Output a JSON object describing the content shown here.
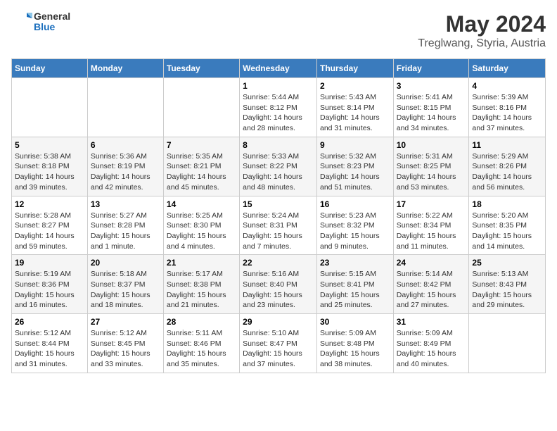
{
  "logo": {
    "general": "General",
    "blue": "Blue"
  },
  "header": {
    "month_year": "May 2024",
    "location": "Treglwang, Styria, Austria"
  },
  "weekdays": [
    "Sunday",
    "Monday",
    "Tuesday",
    "Wednesday",
    "Thursday",
    "Friday",
    "Saturday"
  ],
  "weeks": [
    [
      {
        "day": "",
        "info": ""
      },
      {
        "day": "",
        "info": ""
      },
      {
        "day": "",
        "info": ""
      },
      {
        "day": "1",
        "info": "Sunrise: 5:44 AM\nSunset: 8:12 PM\nDaylight: 14 hours and 28 minutes."
      },
      {
        "day": "2",
        "info": "Sunrise: 5:43 AM\nSunset: 8:14 PM\nDaylight: 14 hours and 31 minutes."
      },
      {
        "day": "3",
        "info": "Sunrise: 5:41 AM\nSunset: 8:15 PM\nDaylight: 14 hours and 34 minutes."
      },
      {
        "day": "4",
        "info": "Sunrise: 5:39 AM\nSunset: 8:16 PM\nDaylight: 14 hours and 37 minutes."
      }
    ],
    [
      {
        "day": "5",
        "info": "Sunrise: 5:38 AM\nSunset: 8:18 PM\nDaylight: 14 hours and 39 minutes."
      },
      {
        "day": "6",
        "info": "Sunrise: 5:36 AM\nSunset: 8:19 PM\nDaylight: 14 hours and 42 minutes."
      },
      {
        "day": "7",
        "info": "Sunrise: 5:35 AM\nSunset: 8:21 PM\nDaylight: 14 hours and 45 minutes."
      },
      {
        "day": "8",
        "info": "Sunrise: 5:33 AM\nSunset: 8:22 PM\nDaylight: 14 hours and 48 minutes."
      },
      {
        "day": "9",
        "info": "Sunrise: 5:32 AM\nSunset: 8:23 PM\nDaylight: 14 hours and 51 minutes."
      },
      {
        "day": "10",
        "info": "Sunrise: 5:31 AM\nSunset: 8:25 PM\nDaylight: 14 hours and 53 minutes."
      },
      {
        "day": "11",
        "info": "Sunrise: 5:29 AM\nSunset: 8:26 PM\nDaylight: 14 hours and 56 minutes."
      }
    ],
    [
      {
        "day": "12",
        "info": "Sunrise: 5:28 AM\nSunset: 8:27 PM\nDaylight: 14 hours and 59 minutes."
      },
      {
        "day": "13",
        "info": "Sunrise: 5:27 AM\nSunset: 8:28 PM\nDaylight: 15 hours and 1 minute."
      },
      {
        "day": "14",
        "info": "Sunrise: 5:25 AM\nSunset: 8:30 PM\nDaylight: 15 hours and 4 minutes."
      },
      {
        "day": "15",
        "info": "Sunrise: 5:24 AM\nSunset: 8:31 PM\nDaylight: 15 hours and 7 minutes."
      },
      {
        "day": "16",
        "info": "Sunrise: 5:23 AM\nSunset: 8:32 PM\nDaylight: 15 hours and 9 minutes."
      },
      {
        "day": "17",
        "info": "Sunrise: 5:22 AM\nSunset: 8:34 PM\nDaylight: 15 hours and 11 minutes."
      },
      {
        "day": "18",
        "info": "Sunrise: 5:20 AM\nSunset: 8:35 PM\nDaylight: 15 hours and 14 minutes."
      }
    ],
    [
      {
        "day": "19",
        "info": "Sunrise: 5:19 AM\nSunset: 8:36 PM\nDaylight: 15 hours and 16 minutes."
      },
      {
        "day": "20",
        "info": "Sunrise: 5:18 AM\nSunset: 8:37 PM\nDaylight: 15 hours and 18 minutes."
      },
      {
        "day": "21",
        "info": "Sunrise: 5:17 AM\nSunset: 8:38 PM\nDaylight: 15 hours and 21 minutes."
      },
      {
        "day": "22",
        "info": "Sunrise: 5:16 AM\nSunset: 8:40 PM\nDaylight: 15 hours and 23 minutes."
      },
      {
        "day": "23",
        "info": "Sunrise: 5:15 AM\nSunset: 8:41 PM\nDaylight: 15 hours and 25 minutes."
      },
      {
        "day": "24",
        "info": "Sunrise: 5:14 AM\nSunset: 8:42 PM\nDaylight: 15 hours and 27 minutes."
      },
      {
        "day": "25",
        "info": "Sunrise: 5:13 AM\nSunset: 8:43 PM\nDaylight: 15 hours and 29 minutes."
      }
    ],
    [
      {
        "day": "26",
        "info": "Sunrise: 5:12 AM\nSunset: 8:44 PM\nDaylight: 15 hours and 31 minutes."
      },
      {
        "day": "27",
        "info": "Sunrise: 5:12 AM\nSunset: 8:45 PM\nDaylight: 15 hours and 33 minutes."
      },
      {
        "day": "28",
        "info": "Sunrise: 5:11 AM\nSunset: 8:46 PM\nDaylight: 15 hours and 35 minutes."
      },
      {
        "day": "29",
        "info": "Sunrise: 5:10 AM\nSunset: 8:47 PM\nDaylight: 15 hours and 37 minutes."
      },
      {
        "day": "30",
        "info": "Sunrise: 5:09 AM\nSunset: 8:48 PM\nDaylight: 15 hours and 38 minutes."
      },
      {
        "day": "31",
        "info": "Sunrise: 5:09 AM\nSunset: 8:49 PM\nDaylight: 15 hours and 40 minutes."
      },
      {
        "day": "",
        "info": ""
      }
    ]
  ]
}
